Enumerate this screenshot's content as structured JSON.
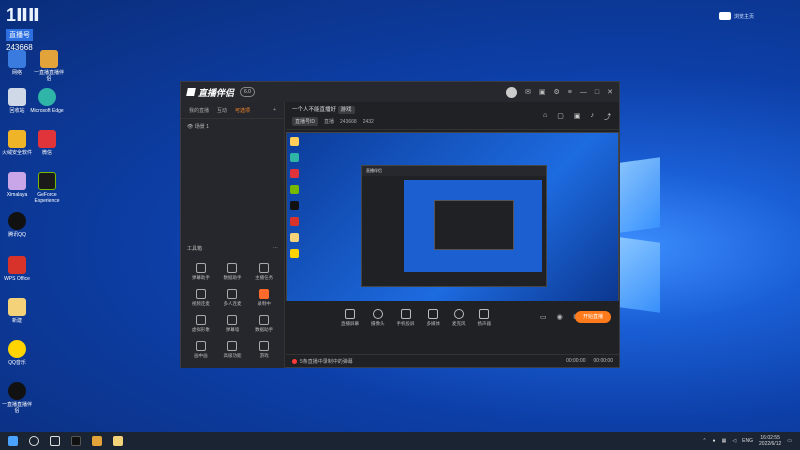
{
  "desktop": {
    "badge": {
      "big": "1ⅡⅡ",
      "sub": "直播号",
      "num": "243668"
    },
    "top_right": "浏览主页",
    "icons": [
      {
        "label": "网络"
      },
      {
        "label": "一直播直播伴侣"
      },
      {
        "label": "回收站"
      },
      {
        "label": "Microsoft Edge"
      },
      {
        "label": "火绒安全软件"
      },
      {
        "label": "微信"
      },
      {
        "label": "Ximalaya"
      },
      {
        "label": "GeForce Experience"
      },
      {
        "label": "腾讯QQ"
      },
      {
        "label": "WPS Office"
      },
      {
        "label": "新建"
      },
      {
        "label": "QQ音乐"
      },
      {
        "label": "一直播直播伴侣"
      }
    ]
  },
  "app": {
    "logo": "直播伴侣",
    "version": "6.0",
    "left_tabs": [
      "我的直播",
      "互动",
      "可选项"
    ],
    "scene": "场景 1",
    "tools_title": "工具箱",
    "tools": [
      {
        "label": "弹幕助手"
      },
      {
        "label": "数据助手"
      },
      {
        "label": "主播任务"
      },
      {
        "label": "视频连麦"
      },
      {
        "label": "多人连麦"
      },
      {
        "label": "录制中"
      },
      {
        "label": "虚拟形象"
      },
      {
        "label": "弹幕墙"
      },
      {
        "label": "数据助手"
      },
      {
        "label": "画中画"
      },
      {
        "label": "高级功能"
      },
      {
        "label": "游戏"
      }
    ],
    "header": {
      "title": "一个人不能直播好",
      "chip": "游戏",
      "tag": "直播号ID",
      "id_label": "直播",
      "viewers": "243668",
      "likes": "2432"
    },
    "controls": [
      {
        "label": "直播屏幕"
      },
      {
        "label": "摄像头"
      },
      {
        "label": "手机投屏"
      },
      {
        "label": "多媒体"
      },
      {
        "label": "麦克风"
      },
      {
        "label": "扬声器"
      }
    ],
    "go_live": "开始直播",
    "status_text": "5条直播中录制中的弹幕",
    "status_time1": "00:00:00",
    "status_time2": "00:00:00"
  },
  "taskbar": {
    "time": "16:02:55",
    "date": "2022/6/12",
    "lang": "ENG"
  }
}
